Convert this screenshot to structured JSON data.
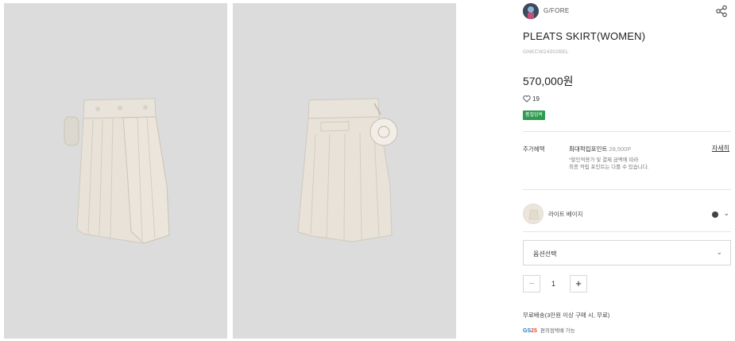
{
  "brand": {
    "name": "G/FORE",
    "logo_icon": "brand-avatar-icon"
  },
  "product": {
    "title": "PLEATS SKIRT(WOMEN)",
    "code": "GNKCW24302BEL",
    "price": "570,000원",
    "likes": "19",
    "badge": "품절임박"
  },
  "benefit": {
    "label": "추가혜택",
    "max_points_label": "최대적립포인트",
    "max_points_value": "28,500P",
    "note_line1": "*할인적용가 및 결제 금액에 따라",
    "note_line2": "최종 적립 포인트는 다를 수 있습니다.",
    "detail_link": "자세히"
  },
  "color": {
    "name": "라이트 베이지",
    "dot_color": "#444444"
  },
  "option": {
    "placeholder": "옵션선택"
  },
  "quantity": {
    "value": "1",
    "minus": "−",
    "plus": "+"
  },
  "shipping": {
    "text": "무료배송(3만원 이상 구매 시, 무료)"
  },
  "gs": {
    "logo_gs": "GS",
    "logo_num": "25",
    "text": "편의점택배 가능"
  },
  "colors": {
    "badge": "#2e9b4f",
    "photo_bg": "#dcdcdc",
    "skirt": "#e7e1d7"
  }
}
